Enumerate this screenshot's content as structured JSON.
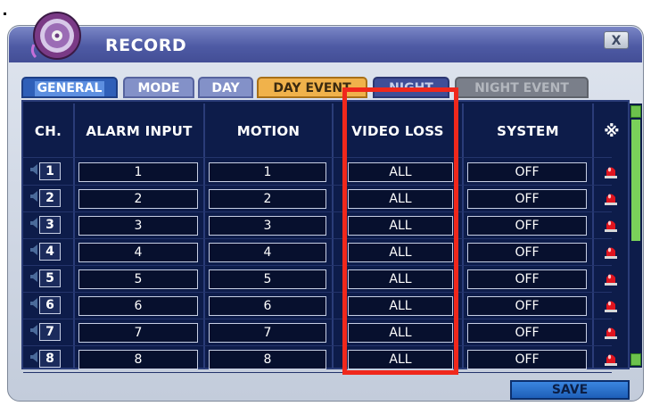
{
  "window": {
    "title": "RECORD",
    "close_label": "X"
  },
  "tabs": [
    {
      "label": "GENERAL"
    },
    {
      "label": "MODE"
    },
    {
      "label": "DAY"
    },
    {
      "label": "DAY EVENT"
    },
    {
      "label": "NIGHT"
    },
    {
      "label": "NIGHT EVENT"
    }
  ],
  "table": {
    "headers": {
      "ch": "CH.",
      "alarm_input": "ALARM INPUT",
      "motion": "MOTION",
      "video_loss": "VIDEO LOSS",
      "system": "SYSTEM",
      "extra": "※"
    },
    "rows": [
      {
        "ch": "1",
        "alarm_input": "1",
        "motion": "1",
        "video_loss": "ALL",
        "system": "OFF"
      },
      {
        "ch": "2",
        "alarm_input": "2",
        "motion": "2",
        "video_loss": "ALL",
        "system": "OFF"
      },
      {
        "ch": "3",
        "alarm_input": "3",
        "motion": "3",
        "video_loss": "ALL",
        "system": "OFF"
      },
      {
        "ch": "4",
        "alarm_input": "4",
        "motion": "4",
        "video_loss": "ALL",
        "system": "OFF"
      },
      {
        "ch": "5",
        "alarm_input": "5",
        "motion": "5",
        "video_loss": "ALL",
        "system": "OFF"
      },
      {
        "ch": "6",
        "alarm_input": "6",
        "motion": "6",
        "video_loss": "ALL",
        "system": "OFF"
      },
      {
        "ch": "7",
        "alarm_input": "7",
        "motion": "7",
        "video_loss": "ALL",
        "system": "OFF"
      },
      {
        "ch": "8",
        "alarm_input": "8",
        "motion": "8",
        "video_loss": "ALL",
        "system": "OFF"
      }
    ]
  },
  "footer": {
    "save_label": "SAVE"
  },
  "icons": {
    "logo": "record-disc-icon",
    "alarm": "siren-icon",
    "speaker": "speaker-icon"
  },
  "colors": {
    "highlight": "#f0281c",
    "active_tab": "#2f5fb8",
    "day_event_tab": "#f0b24b"
  }
}
